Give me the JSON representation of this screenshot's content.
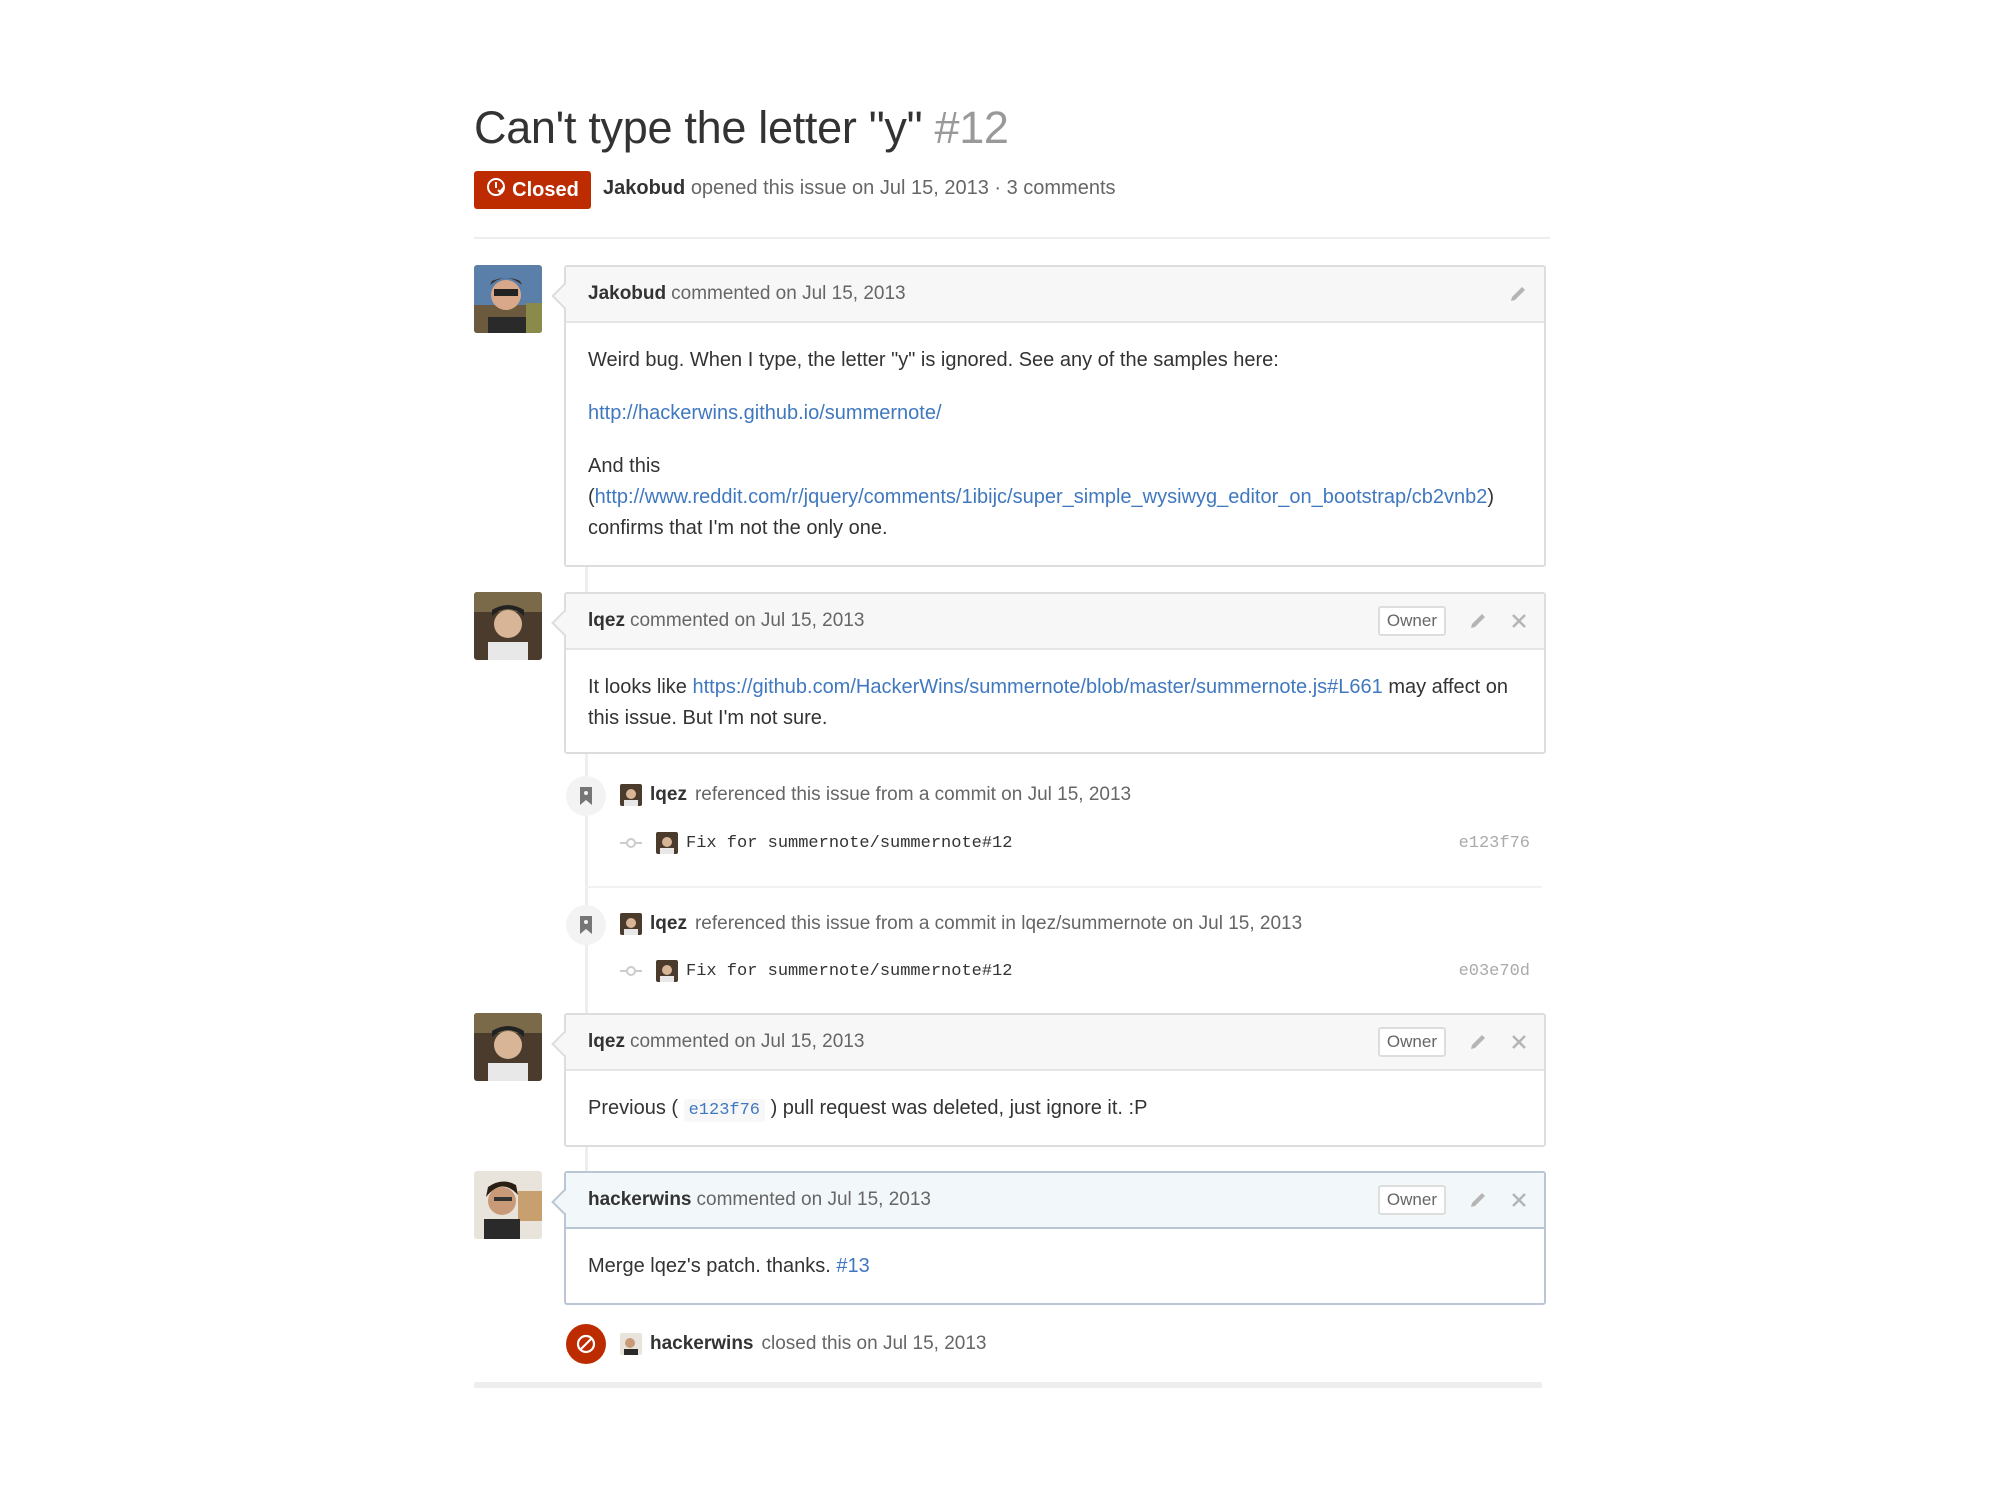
{
  "issue": {
    "title": "Can't type the letter \"y\"",
    "number": "#12",
    "state": "Closed",
    "author": "Jakobud",
    "meta": "opened this issue on Jul 15, 2013 · 3 comments"
  },
  "comments": [
    {
      "author": "Jakobud",
      "when": "commented on Jul 15, 2013",
      "line1": "Weird bug. When I type, the letter \"y\" is ignored. See any of the samples here:",
      "link1": "http://hackerwins.github.io/summernote/",
      "line2a": "And this",
      "line2b_open": "(",
      "link2": "http://www.reddit.com/r/jquery/comments/1ibijc/super_simple_wysiwyg_editor_on_bootstrap/cb2vnb2",
      "line2b_close": ")",
      "line3": "confirms that I'm not the only one."
    },
    {
      "author": "lqez",
      "when": "commented on Jul 15, 2013",
      "badge": "Owner",
      "pre": "It looks like ",
      "link": "https://github.com/HackerWins/summernote/blob/master/summernote.js#L661",
      "post_a": " may affect on",
      "post_b": "this issue. But I'm not sure."
    },
    {
      "author": "lqez",
      "when": "commented on Jul 15, 2013",
      "badge": "Owner",
      "pre": "Previous ( ",
      "sha": "e123f76",
      "post": " ) pull request was deleted, just ignore it. :P"
    },
    {
      "author": "hackerwins",
      "when": "commented on Jul 15, 2013",
      "badge": "Owner",
      "pre": "Merge lqez's patch. thanks. ",
      "link": "#13"
    }
  ],
  "events": [
    {
      "actor": "lqez",
      "text": "referenced this issue from a commit on Jul 15, 2013",
      "commit_msg": "Fix for summernote/summernote#12",
      "commit_sha": "e123f76"
    },
    {
      "actor": "lqez",
      "text": "referenced this issue from a commit in lqez/summernote on Jul 15, 2013",
      "commit_msg": "Fix for summernote/summernote#12",
      "commit_sha": "e03e70d"
    }
  ],
  "close_event": {
    "actor": "hackerwins",
    "text": "closed this on Jul 15, 2013"
  },
  "icons": {
    "state": "issue-closed-icon",
    "edit": "pencil-icon",
    "delete": "close-icon",
    "reference": "bookmark-icon",
    "commit": "git-commit-icon",
    "closed": "circle-slash-icon"
  },
  "colors": {
    "closed_red": "#bd2c00",
    "link_blue": "#4078c0",
    "owner_header_bg": "#f2f8fa"
  }
}
